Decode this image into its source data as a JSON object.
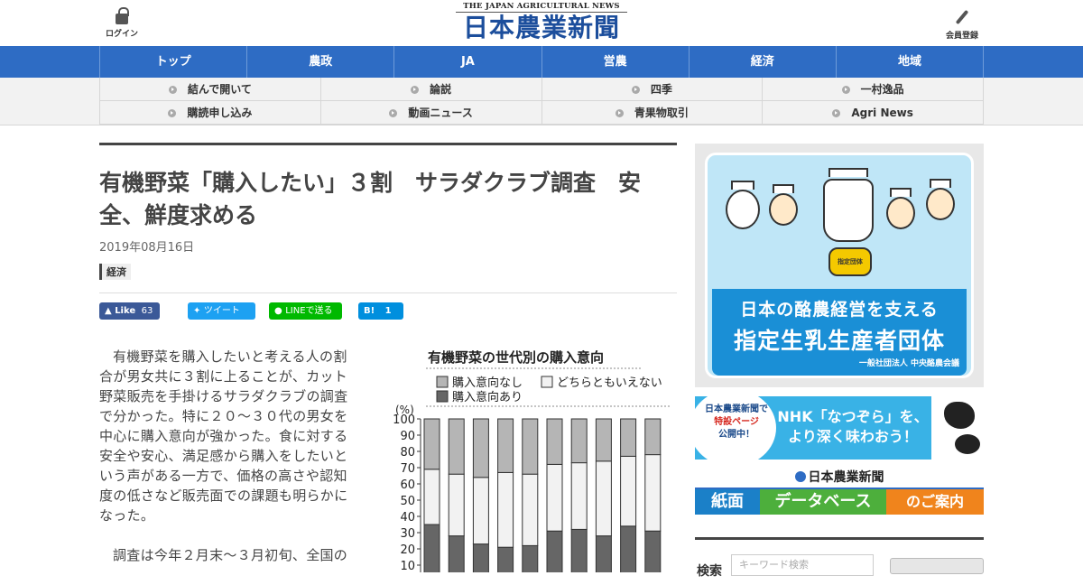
{
  "header": {
    "login_label": "ログイン",
    "logo_en": "THE JAPAN AGRICULTURAL NEWS",
    "logo_jp": "日本農業新聞",
    "member_label": "会員登録"
  },
  "nav": [
    "トップ",
    "農政",
    "JA",
    "営農",
    "経済",
    "地域"
  ],
  "subnav": [
    "結んで開いて",
    "論説",
    "四季",
    "一村逸品",
    "購読申し込み",
    "動画ニュース",
    "青果物取引",
    "Agri News"
  ],
  "article": {
    "title": "有機野菜「購入したい」３割　サラダクラブ調査　安全、鮮度求める",
    "date": "2019年08月16日",
    "category": "経済",
    "share": {
      "fb_label": "Like",
      "fb_count": "63",
      "tweet_label": "ツイート",
      "line_label": "LINEで送る",
      "hatena_label": "B!",
      "hatena_count": "1"
    },
    "paragraphs": [
      "有機野菜を購入したいと考える人の割合が男女共に３割に上ることが、カット野菜販売を手掛けるサラダクラブの調査で分かった。特に２０～３０代の男女を中心に購入意向が強かった。食に対する安全や安心、満足感から購入をしたいという声がある一方で、価格の高さや認知度の低さなど販売面での課題も明らかになった。",
      "調査は今年２月末～３月初旬、全国の"
    ]
  },
  "chart_data": {
    "type": "bar",
    "stacked": true,
    "title": "有機野菜の世代別の購入意向",
    "ylabel": "(%)",
    "ylim": [
      0,
      100
    ],
    "yticks": [
      10,
      20,
      30,
      40,
      50,
      60,
      70,
      80,
      90,
      100
    ],
    "legend": [
      "購入意向なし",
      "どちらともいえない",
      "購入意向あり"
    ],
    "series": [
      {
        "name": "購入意向あり",
        "color": "#666666",
        "values": [
          35,
          28,
          23,
          21,
          22,
          31,
          32,
          28,
          34,
          31
        ]
      },
      {
        "name": "どちらともいえない",
        "color": "#f2f2f2",
        "values": [
          34,
          38,
          41,
          46,
          44,
          41,
          41,
          46,
          43,
          47
        ]
      },
      {
        "name": "購入意向なし",
        "color": "#b5b5b5",
        "values": [
          31,
          34,
          36,
          33,
          34,
          28,
          27,
          26,
          23,
          22
        ]
      }
    ]
  },
  "sidebar": {
    "ad1": {
      "line1": "日本の酪農経営を支える",
      "line2": "指定生乳生産者団体",
      "org": "一般社団法人 中央酪農会議",
      "badge": "指定団体"
    },
    "ad2": {
      "line1": "日本農業新聞で",
      "line2": "特設ページ",
      "line3": "公開中！",
      "main1": "NHK「なつぞら」を、",
      "main2": "より深く味わおう！"
    },
    "ad3": {
      "logo": "日本農業新聞",
      "seg1": "紙面",
      "seg2": "データベース",
      "seg3": "のご案内"
    },
    "search": {
      "label": "検索",
      "placeholder": "キーワード検索"
    }
  }
}
